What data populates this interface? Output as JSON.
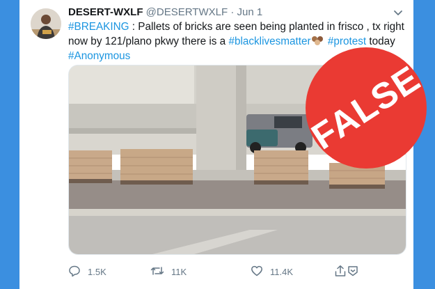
{
  "tweet": {
    "display_name": "DESERT-WXLF",
    "handle": "@DESERTWXLF",
    "separator": "·",
    "date": "Jun 1",
    "text": {
      "tag_breaking": "#BREAKING",
      "part1": " : Pallets of bricks are seen being planted in frisco , tx right now by 121/plano pkwy there is a ",
      "tag_blm": "#blacklivesmatter",
      "part2": " ",
      "tag_protest": "#protest",
      "part3": " today ",
      "tag_anonymous": "#Anonymous"
    },
    "emoji_icon": "raised-fists-emoji"
  },
  "actions": {
    "replies": "1.5K",
    "retweets": "11K",
    "likes": "11.4K"
  },
  "badge": {
    "label": "FALSE",
    "color": "#ea3a33"
  },
  "colors": {
    "link": "#1b95e0",
    "background": "#3b8fe0"
  }
}
